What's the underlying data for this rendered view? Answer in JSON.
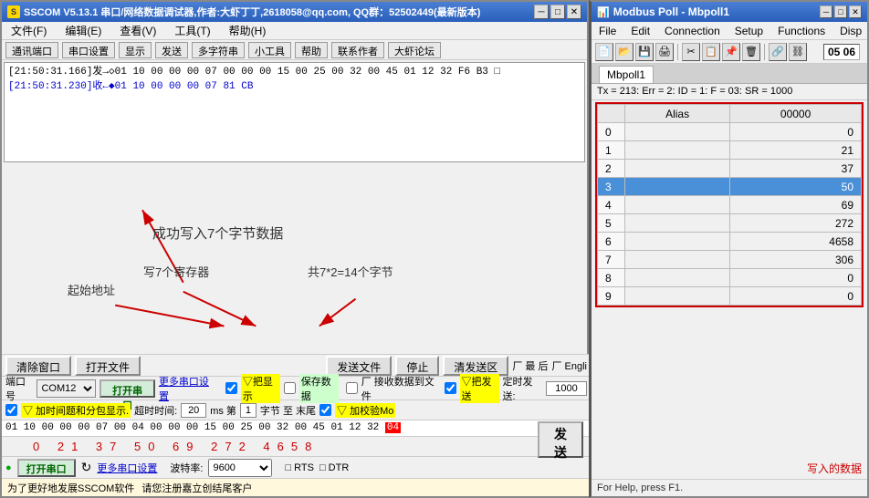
{
  "main_window": {
    "title": "SSCOM V5.13.1 串口/网络数据调试器,作者:大虾丁丁,2618058@qq.com, QQ群：52502449(最新版本)",
    "icon": "S",
    "menu": [
      "文件(F)",
      "编辑(E)",
      "查看(V)",
      "工具(T)",
      "帮助(H)"
    ],
    "toolbar": [
      "通讯端口",
      "串口设置",
      "显示",
      "发送",
      "多字符串",
      "小工具",
      "帮助",
      "联系作者",
      "大虾论坛"
    ],
    "log_lines": [
      "[21:50:31.166]发→◇01 10 00 00 00 07 00 00 00 15 00 25 00 32 00 45 01 12 32 F6 B3 □",
      "[21:50:31.230]收←◆01 10 00 00 00 07 81 CB"
    ],
    "annotation_main": "成功写入7个字节数据",
    "annotation_start_addr": "起始地址",
    "annotation_write7": "写7个寄存器",
    "annotation_14bytes": "共7*2=14个字节",
    "btn_clear": "清除窗口",
    "btn_open_file": "打开文件",
    "btn_send_file": "发送文件",
    "btn_stop": "停止",
    "btn_send_area": "清发送区",
    "chk_last": "厂 最 后",
    "chk_engli": "厂 Engli",
    "port_label": "端口号",
    "port_value": "COM12",
    "open_port_btn": "打开串口",
    "more_settings": "更多串口设置",
    "chk_hex_display": "▽把显示",
    "chk_save_data": "保存数据",
    "chk_receive_file": "厂 接收数据到文件",
    "chk_hex_send": "▽把发送",
    "timer_send": "定时发送:",
    "timer_value": "1000",
    "chk_add_time": "▽ 加时间题和分包显示.",
    "timeout_label": "超时时间:",
    "timeout_value": "20",
    "ms_label": "ms 第",
    "page_num": "1",
    "word_label": "字节 至 末尾",
    "chk_checksum": "▽ 加校验Mo",
    "hex_data": "01 10 00 00 00 07 00 04 00 00 00 15 00 25 00 32 00 45 01 12 32",
    "numbers_row": "0  21  37  50  69  272  4658",
    "baud_label": "波特率:",
    "baud_value": "9600",
    "rts_label": "□ RTS",
    "dtr_label": "□ DTR",
    "send_btn": "发 送",
    "notice_line1": "为了更好地发展SSCOM软件",
    "notice_line2": "请您注册嘉立创结尾客户"
  },
  "modbus_window": {
    "title": "Modbus Poll - Mbpoll1",
    "menu": [
      "File",
      "Edit",
      "Connection",
      "Setup",
      "Functions",
      "Disp"
    ],
    "toolbar_buttons": [
      "new",
      "open",
      "save",
      "print",
      "cut",
      "copy",
      "paste",
      "delete",
      "connect",
      "disconnect"
    ],
    "time_display": "05 06",
    "tab_name": "Mbpoll1",
    "status_line": "Tx = 213: Err = 2: ID = 1: F = 03: SR = 1000",
    "col_header_alias": "Alias",
    "col_header_value": "00000",
    "rows": [
      {
        "index": "0",
        "value": "0"
      },
      {
        "index": "1",
        "value": "21"
      },
      {
        "index": "2",
        "value": "37"
      },
      {
        "index": "3",
        "value": "50",
        "highlighted": true
      },
      {
        "index": "4",
        "value": "69"
      },
      {
        "index": "5",
        "value": "272"
      },
      {
        "index": "6",
        "value": "4658"
      },
      {
        "index": "7",
        "value": "306"
      },
      {
        "index": "8",
        "value": "0"
      },
      {
        "index": "9",
        "value": "0"
      }
    ],
    "written_data_label": "写入的数据",
    "status_bar": "For Help, press F1."
  },
  "icons": {
    "window_icon": "■",
    "minimize": "─",
    "maximize": "□",
    "close": "✕",
    "radio_on": "●",
    "radio_off": "○"
  },
  "colors": {
    "accent_red": "#cc0000",
    "highlight_blue": "#4a90d9",
    "title_blue": "#2a5fbb",
    "bg_light": "#f0f0f0",
    "yellow_hl": "#ffff00"
  }
}
